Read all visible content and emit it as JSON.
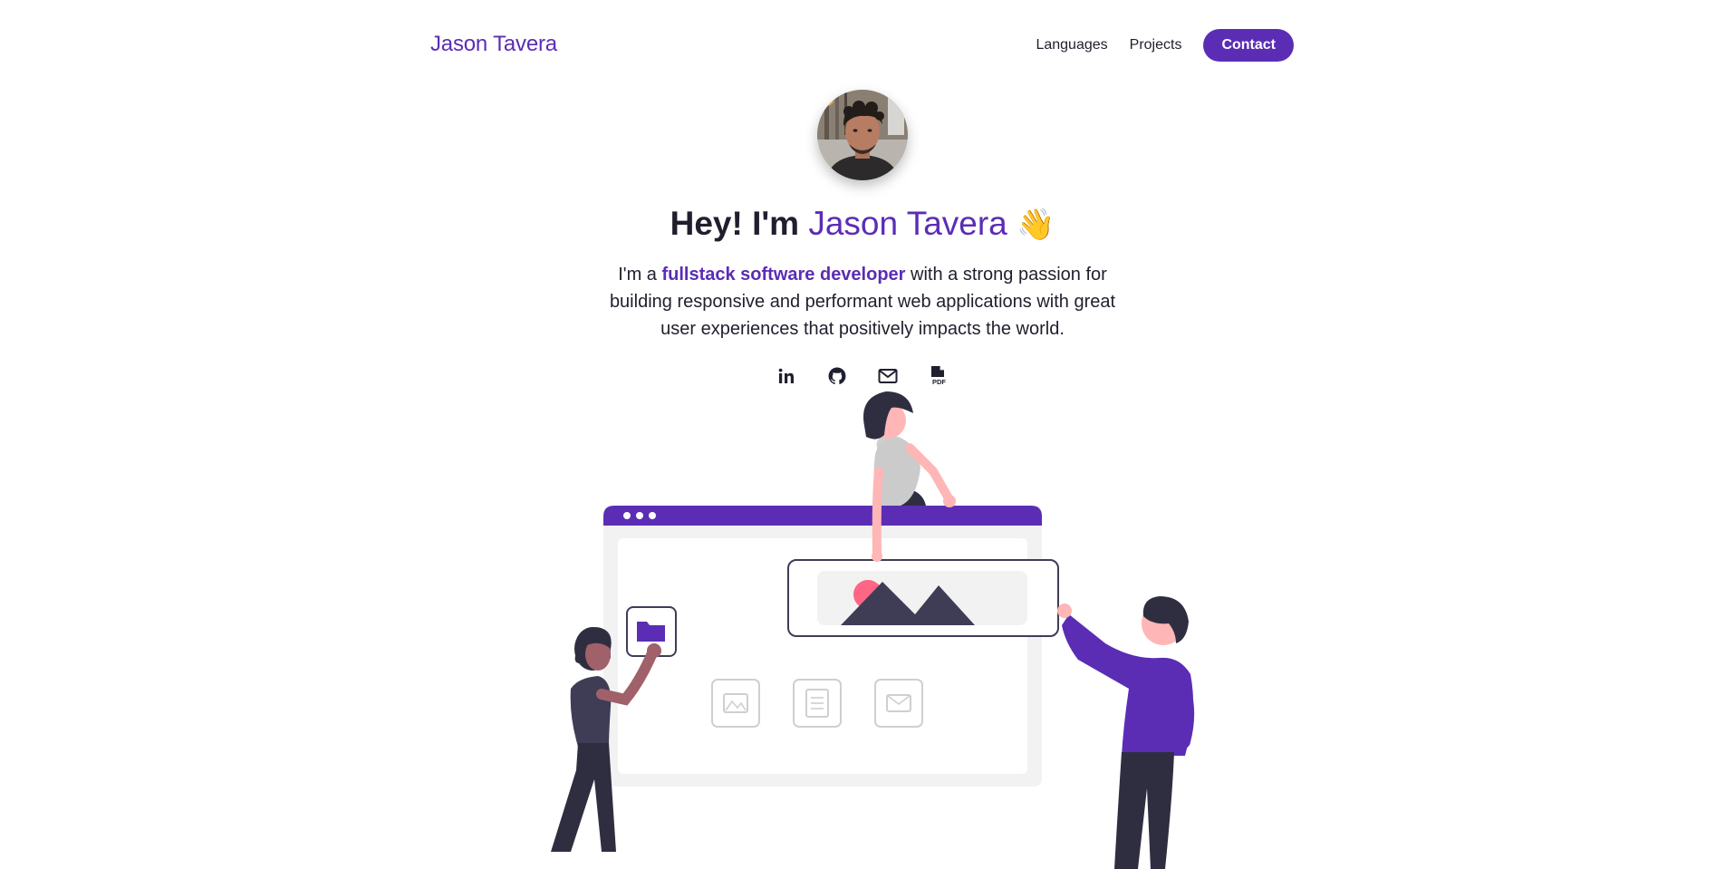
{
  "nav": {
    "brand": "Jason Tavera",
    "links": [
      "Languages",
      "Projects"
    ],
    "contact_label": "Contact"
  },
  "hero": {
    "title_prefix": "Hey! I'm ",
    "title_name": "Jason Tavera",
    "title_emoji": "👋",
    "desc_pre": "I'm a ",
    "desc_highlight": "fullstack software developer",
    "desc_post": " with a strong passion for building responsive and performant web applications with great user experiences that positively impacts the world."
  },
  "socials": [
    {
      "icon": "linkedin-icon"
    },
    {
      "icon": "github-icon"
    },
    {
      "icon": "mail-icon"
    },
    {
      "icon": "pdf-resume-icon"
    }
  ],
  "colors": {
    "accent": "#5b2db5",
    "text": "#1f1f2e",
    "background": "#ffffff"
  }
}
